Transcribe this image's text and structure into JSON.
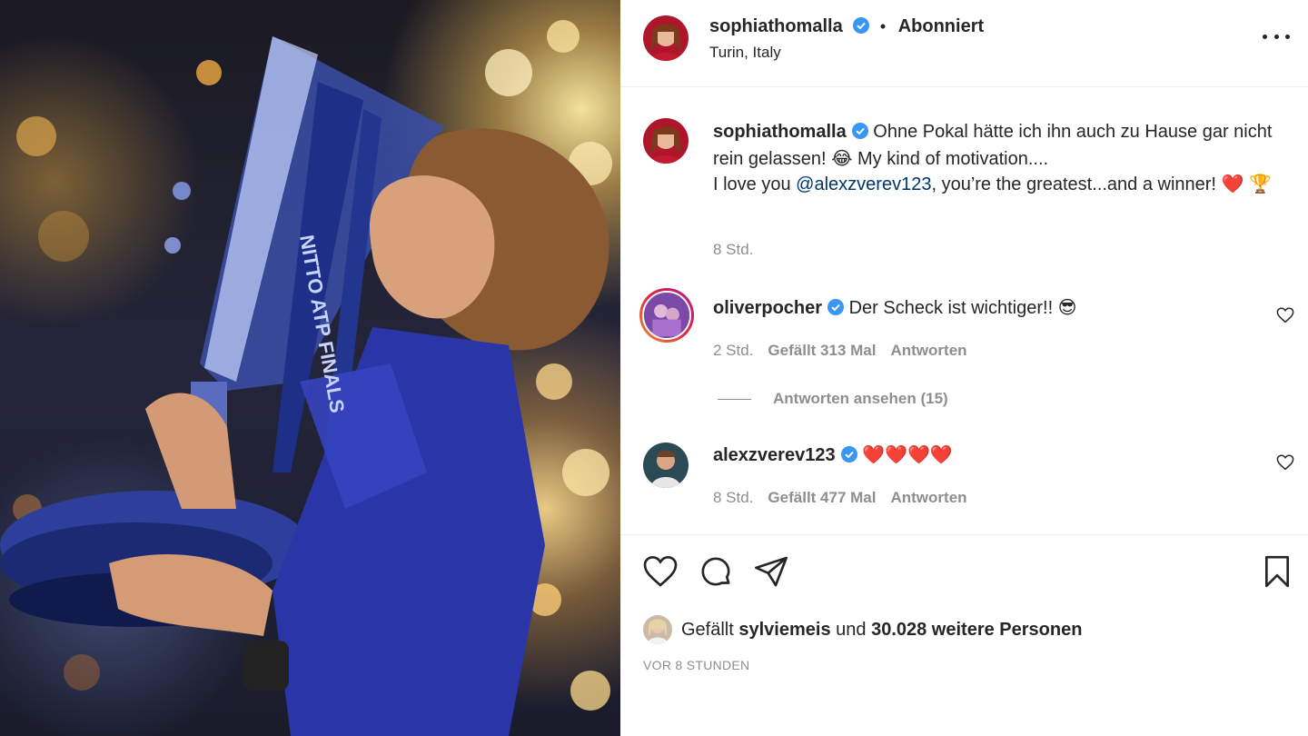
{
  "post": {
    "author": "sophiathomalla",
    "follow_status": "Abonniert",
    "location": "Turin, Italy",
    "photo_text": [
      "NITTO ATP FINALS"
    ]
  },
  "caption": {
    "username": "sophiathomalla",
    "text_part1": "Ohne Pokal hätte ich ihn auch zu Hause gar nicht rein gelassen! 😂 My kind of motivation....",
    "text_part2": "I love you ",
    "mention": "@alexzverev123",
    "text_part3": ", you’re the greatest...and a winner! ❤️ 🏆",
    "time": "8 Std."
  },
  "comments": [
    {
      "username": "oliverpocher",
      "text": "Der Scheck ist wichtiger!! 😎",
      "time": "2 Std.",
      "likes": "Gefällt 313 Mal",
      "reply": "Antworten"
    },
    {
      "username": "alexzverev123",
      "text": "❤️❤️❤️❤️",
      "time": "8 Std.",
      "likes": "Gefällt 477 Mal",
      "reply": "Antworten"
    }
  ],
  "view_replies": "Antworten ansehen (15)",
  "likes_line": {
    "prefix": "Gefällt ",
    "user": "sylviemeis",
    "middle": " und ",
    "count": "30.028 weitere Personen"
  },
  "timestamp": "VOR 8 STUNDEN",
  "colors": {
    "verified": "#3897f0",
    "mention": "#00376b",
    "muted": "#8e8e8e",
    "text": "#262626",
    "heart_emoji": "#e0245e"
  },
  "icons": [
    "verified-icon",
    "more-options-icon",
    "like-icon",
    "comment-icon",
    "share-icon",
    "save-icon",
    "comment-like-icon"
  ]
}
